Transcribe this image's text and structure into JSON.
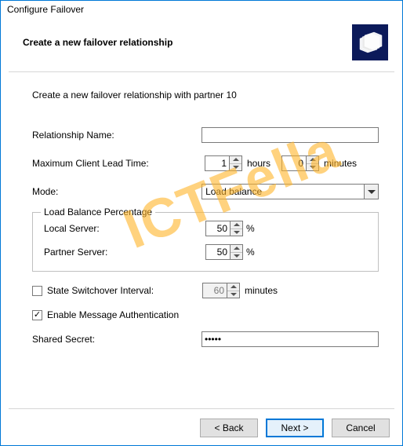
{
  "dialogTitle": "Configure Failover",
  "header": {
    "title": "Create a new failover relationship"
  },
  "intro": "Create a new failover relationship with partner 10",
  "fields": {
    "relationshipName": {
      "label": "Relationship Name:",
      "value": ""
    },
    "maxClientLeadTime": {
      "label": "Maximum Client Lead Time:",
      "hours": "1",
      "hoursUnit": "hours",
      "minutes": "0",
      "minutesUnit": "minutes"
    },
    "mode": {
      "label": "Mode:",
      "value": "Load balance"
    },
    "loadBalance": {
      "groupTitle": "Load Balance Percentage",
      "localLabel": "Local Server:",
      "localValue": "50",
      "partnerLabel": "Partner Server:",
      "partnerValue": "50",
      "pct": "%"
    },
    "stateSwitchover": {
      "label": "State Switchover Interval:",
      "value": "60",
      "unit": "minutes",
      "checked": false
    },
    "enableMsgAuth": {
      "label": "Enable Message Authentication",
      "checked": true
    },
    "sharedSecret": {
      "label": "Shared Secret:",
      "value": "•••••"
    }
  },
  "buttons": {
    "back": "< Back",
    "next": "Next >",
    "cancel": "Cancel"
  },
  "watermark": "ICTFella"
}
